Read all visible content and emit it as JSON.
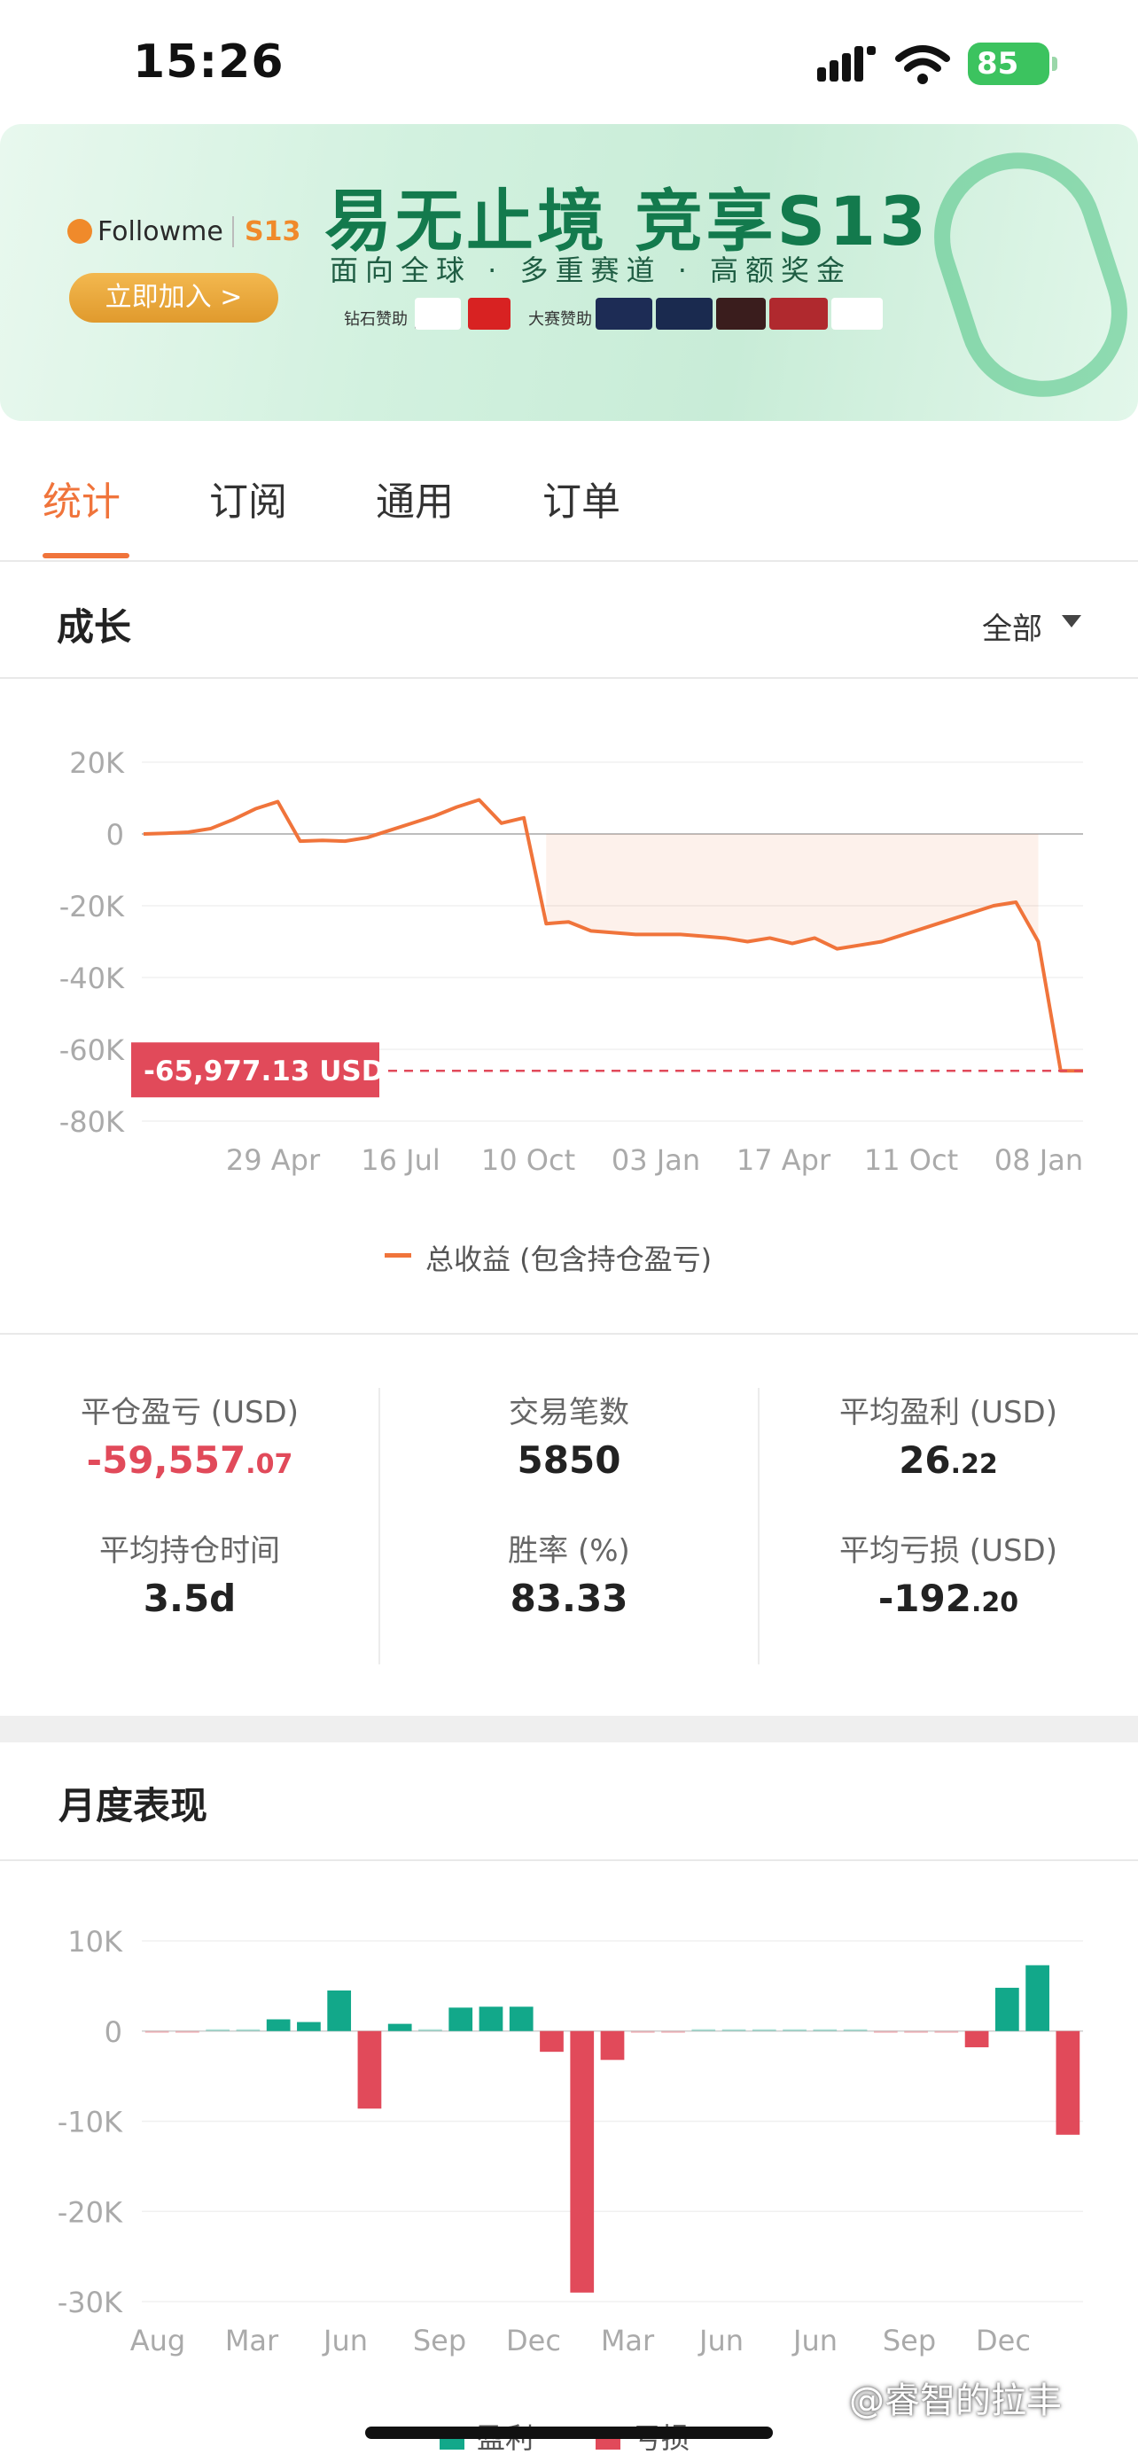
{
  "status_bar": {
    "time": "15:26",
    "battery": "85"
  },
  "banner": {
    "brand": "Followme",
    "brand_tag": "S13",
    "join_button": "立即加入 >",
    "title": "易无止境 竞享S13",
    "subtitle": "面向全球 · 多重赛道 · 高额奖金",
    "sponsor_diamond": "钻石赞助 |",
    "sponsor_event": "大赛赞助 |"
  },
  "tabs": [
    {
      "label": "统计",
      "active": true
    },
    {
      "label": "订阅",
      "active": false
    },
    {
      "label": "通用",
      "active": false
    },
    {
      "label": "订单",
      "active": false
    }
  ],
  "growth": {
    "title": "成长",
    "filter": "全部",
    "current_label": "-65,977.13 USD",
    "legend": "总收益 (包含持仓盈亏)",
    "accent": "#f0743b"
  },
  "chart_data": [
    {
      "type": "line",
      "y_ticks": [
        "20K",
        "0",
        "-20K",
        "-40K",
        "-60K",
        "-80K"
      ],
      "x_ticks": [
        "29 Apr",
        "16 Jul",
        "10 Oct",
        "03 Jan",
        "17 Apr",
        "11 Oct",
        "08 Jan"
      ],
      "ylim": [
        -80000,
        20000
      ],
      "series": [
        {
          "name": "总收益 (包含持仓盈亏)",
          "x": [
            0,
            1,
            2,
            3,
            4,
            5,
            6,
            7,
            8,
            9,
            10,
            11,
            12,
            13,
            14,
            15,
            16,
            17,
            18,
            19,
            20,
            21,
            22,
            23,
            24,
            25,
            26,
            27,
            28,
            29,
            30,
            31,
            32,
            33,
            34,
            35,
            36,
            37,
            38,
            39,
            40,
            41,
            42
          ],
          "values": [
            0,
            200,
            500,
            1500,
            4000,
            7000,
            9000,
            -2000,
            -1800,
            -2000,
            -1000,
            1000,
            3000,
            5000,
            7500,
            9500,
            3000,
            4500,
            -25000,
            -24500,
            -27000,
            -27500,
            -28000,
            -28000,
            -28000,
            -28500,
            -29000,
            -30000,
            -29000,
            -30500,
            -29000,
            -32000,
            -31000,
            -30000,
            -28000,
            -26000,
            -24000,
            -22000,
            -20000,
            -19000,
            -30000,
            -66000,
            -65977.13
          ]
        }
      ],
      "current_value": -65977.13
    },
    {
      "type": "bar",
      "y_ticks": [
        "10K",
        "0",
        "-10K",
        "-20K",
        "-30K"
      ],
      "x_ticks": [
        "Aug",
        "Mar",
        "Jun",
        "Sep",
        "Dec",
        "Mar",
        "Jun",
        "Jun",
        "Sep",
        "Dec"
      ],
      "ylim": [
        -30000,
        10000
      ],
      "values": [
        -100,
        -100,
        0,
        0,
        1300,
        1000,
        4500,
        -8600,
        800,
        200,
        2600,
        2700,
        2700,
        -2300,
        -29000,
        -3200,
        -200,
        -200,
        200,
        100,
        0,
        0,
        0,
        100,
        -200,
        -200,
        -200,
        -1800,
        4800,
        7300,
        -11500
      ],
      "series": [
        {
          "name": "盈利",
          "color": "#12a88a"
        },
        {
          "name": "亏损",
          "color": "#e14a5a"
        }
      ]
    }
  ],
  "stats": {
    "closed_pl_label": "平仓盈亏 (USD)",
    "closed_pl_int": "-59,557",
    "closed_pl_dec": ".07",
    "trades_label": "交易笔数",
    "trades_value": "5850",
    "avg_profit_label": "平均盈利 (USD)",
    "avg_profit_int": "26",
    "avg_profit_dec": ".22",
    "avg_hold_label": "平均持仓时间",
    "avg_hold_value": "3.5d",
    "win_rate_label": "胜率 (%)",
    "win_rate_value": "83.33",
    "avg_loss_label": "平均亏损 (USD)",
    "avg_loss_int": "-192",
    "avg_loss_dec": ".20"
  },
  "monthly": {
    "title": "月度表现",
    "legend_profit": "盈利",
    "legend_loss": "亏损",
    "profit_color": "#12a88a",
    "loss_color": "#e14a5a"
  },
  "watermark": "@睿智的拉丰"
}
